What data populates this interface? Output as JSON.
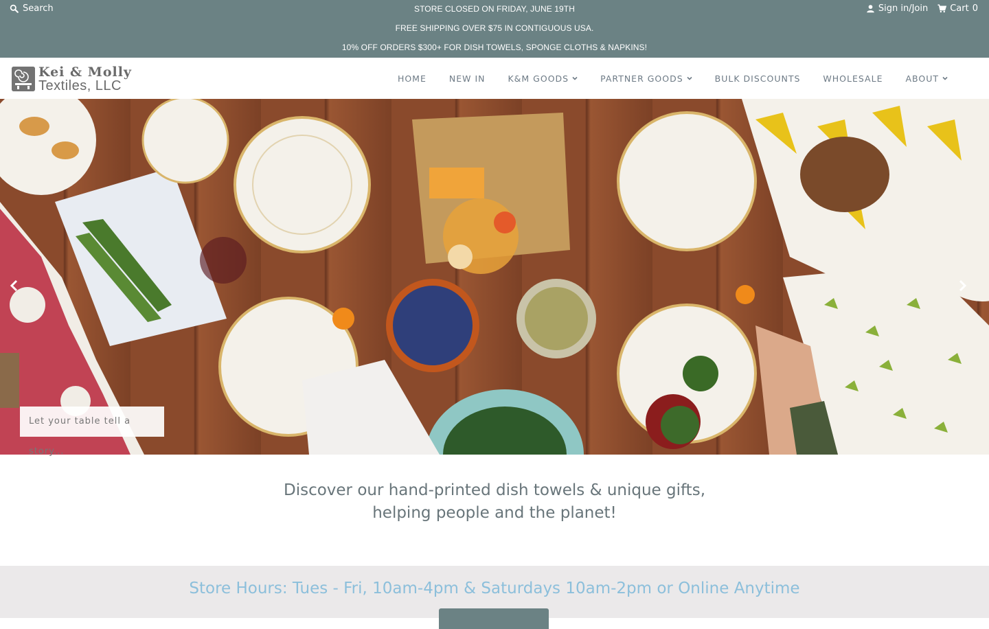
{
  "topbar": {
    "search_label": "Search",
    "announcements": [
      "STORE CLOSED ON FRIDAY, JUNE 19TH",
      "FREE SHIPPING OVER $75 IN CONTIGUOUS USA.",
      "10% OFF ORDERS $300+ FOR DISH TOWELS, SPONGE CLOTHS & NAPKINS!"
    ],
    "sign_in_label": "Sign in/Join",
    "cart_label": "Cart",
    "cart_count": "0"
  },
  "logo": {
    "line1": "Kei & Molly",
    "line2": "Textiles, LLC"
  },
  "nav": {
    "items": [
      {
        "label": "HOME"
      },
      {
        "label": "NEW IN"
      },
      {
        "label": "K&M GOODS",
        "has_dropdown": true
      },
      {
        "label": "PARTNER GOODS",
        "has_dropdown": true
      },
      {
        "label": "BULK DISCOUNTS"
      },
      {
        "label": "WHOLESALE"
      },
      {
        "label": "ABOUT",
        "has_dropdown": true
      }
    ]
  },
  "hero": {
    "caption": "Let your table tell a story..."
  },
  "intro": {
    "line1": "Discover our hand-printed dish towels & unique gifts,",
    "line2": "helping people and the planet!"
  },
  "hours": {
    "text": "Store Hours: Tues - Fri, 10am-4pm & Saturdays 10am-2pm or Online Anytime"
  },
  "colors": {
    "topbar": "#6b8284",
    "nav_text": "#6d7a85",
    "intro_text": "#68757a",
    "hours_bg": "#ebe9ea",
    "hours_text": "#8cbfdb"
  }
}
